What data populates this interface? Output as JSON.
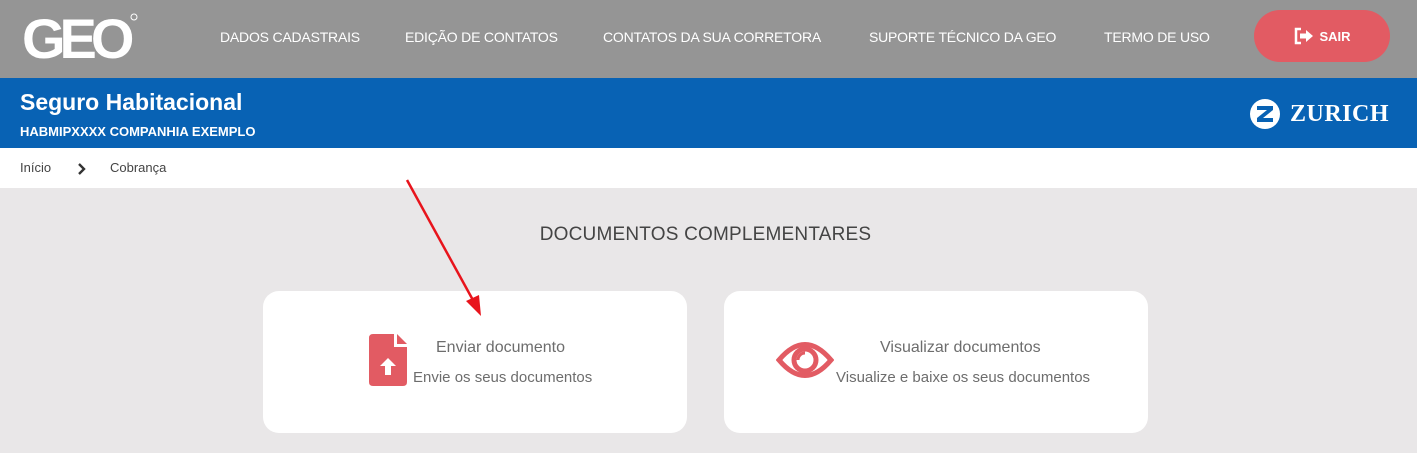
{
  "header": {
    "logo_text": "GEO",
    "nav": [
      "DADOS CADASTRAIS",
      "EDIÇÃO DE CONTATOS",
      "CONTATOS DA SUA CORRETORA",
      "SUPORTE TÉCNICO DA GEO",
      "TERMO DE USO"
    ],
    "logout_label": "SAIR"
  },
  "banner": {
    "title": "Seguro Habitacional",
    "policy_code": "HABMIPXXXX",
    "company": "COMPANHIA EXEMPLO",
    "brand_name": "ZURICH"
  },
  "breadcrumb": {
    "items": [
      "Início",
      "Cobrança"
    ]
  },
  "main": {
    "section_title": "DOCUMENTOS COMPLEMENTARES",
    "cards": [
      {
        "title": "Enviar documento",
        "description": "Envie os seus documentos",
        "icon": "file-upload-icon"
      },
      {
        "title": "Visualizar documentos",
        "description": "Visualize e baixe os seus documentos",
        "icon": "eye-icon"
      }
    ]
  },
  "colors": {
    "topbar": "#959595",
    "banner": "#0862b4",
    "accent": "#e25b63",
    "annotation_arrow": "#e8141c"
  }
}
